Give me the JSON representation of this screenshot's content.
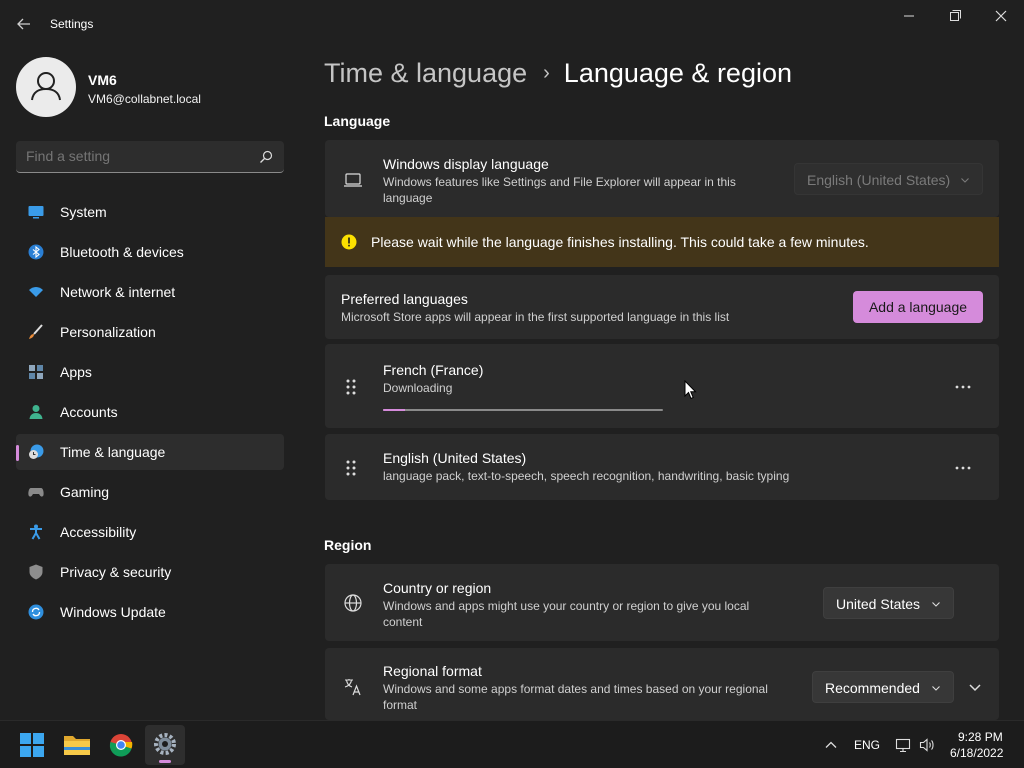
{
  "window": {
    "title": "Settings"
  },
  "user": {
    "name": "VM6",
    "email": "VM6@collabnet.local"
  },
  "search": {
    "placeholder": "Find a setting"
  },
  "accent_color": "#d58bdb",
  "nav": {
    "selected": "Time & language",
    "items": [
      {
        "label": "System",
        "icon": "system-icon"
      },
      {
        "label": "Bluetooth & devices",
        "icon": "bluetooth-icon"
      },
      {
        "label": "Network & internet",
        "icon": "wifi-icon"
      },
      {
        "label": "Personalization",
        "icon": "brush-icon"
      },
      {
        "label": "Apps",
        "icon": "apps-icon"
      },
      {
        "label": "Accounts",
        "icon": "person-icon"
      },
      {
        "label": "Time & language",
        "icon": "clock-globe-icon"
      },
      {
        "label": "Gaming",
        "icon": "gamepad-icon"
      },
      {
        "label": "Accessibility",
        "icon": "accessibility-icon"
      },
      {
        "label": "Privacy & security",
        "icon": "shield-icon"
      },
      {
        "label": "Windows Update",
        "icon": "update-icon"
      }
    ]
  },
  "breadcrumb": {
    "parent": "Time & language",
    "separator": "›",
    "current": "Language & region"
  },
  "language": {
    "section_title": "Language",
    "display_language": {
      "title": "Windows display language",
      "description": "Windows features like Settings and File Explorer will appear in this language",
      "dropdown_value": "English (United States)",
      "dropdown_disabled": true
    },
    "warning": {
      "text": "Please wait while the language finishes installing. This could take a few minutes."
    },
    "preferred": {
      "title": "Preferred languages",
      "description": "Microsoft Store apps will appear in the first supported language in this list",
      "add_button": "Add a language"
    },
    "languages": [
      {
        "name": "French (France)",
        "status": "Downloading",
        "progress": 0.08
      },
      {
        "name": "English (United States)",
        "features": "language pack, text-to-speech, speech recognition, handwriting, basic typing"
      }
    ]
  },
  "region": {
    "section_title": "Region",
    "country": {
      "title": "Country or region",
      "description": "Windows and apps might use your country or region to give you local content",
      "value": "United States"
    },
    "format": {
      "title": "Regional format",
      "description": "Windows and some apps format dates and times based on your regional format",
      "value": "Recommended"
    }
  },
  "taskbar": {
    "apps": [
      "start-icon",
      "file-explorer-icon",
      "chrome-icon",
      "settings-icon"
    ],
    "active_app": "settings-icon",
    "tray": {
      "input_language": "ENG",
      "time": "9:28 PM",
      "date": "6/18/2022"
    }
  }
}
